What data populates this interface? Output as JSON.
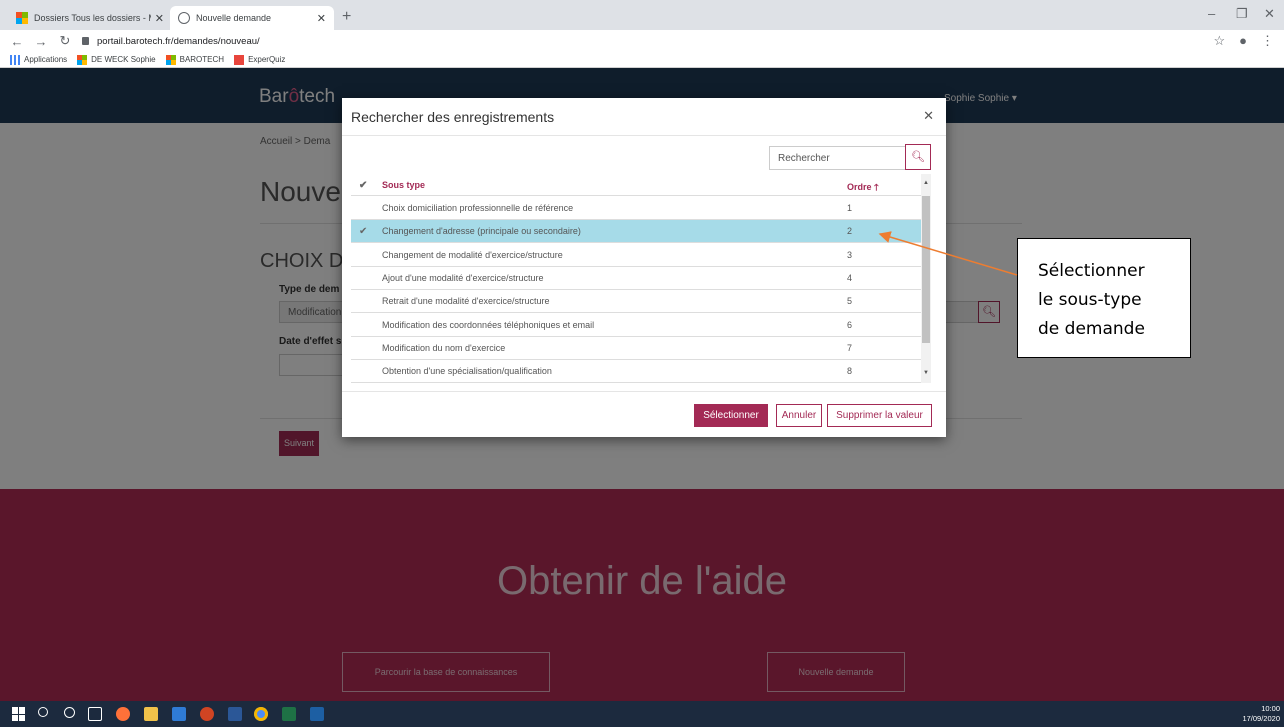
{
  "browser": {
    "tabs": [
      {
        "label": "Dossiers Tous les dossiers - Micr"
      },
      {
        "label": "Nouvelle demande"
      }
    ],
    "url": "portail.barotech.fr/demandes/nouveau/",
    "bookmarks": [
      "Applications",
      "DE WECK Sophie",
      "BAROTECH",
      "ExperQuiz"
    ]
  },
  "site": {
    "logo_a": "Bar",
    "logo_o": "ô",
    "logo_b": "tech",
    "user": "Sophie Sophie ▾",
    "breadcrumb": "Accueil  >  Dema",
    "page_title": "Nouve",
    "section_title": "CHOIX D",
    "type_label": "Type de dem",
    "type_value": "Modification",
    "date_label": "Date d'effet s",
    "next_button": "Suivant",
    "help_title": "Obtenir de l'aide",
    "help_browse": "Parcourir la base de connaissances",
    "help_new": "Nouvelle demande"
  },
  "modal": {
    "title": "Rechercher des enregistrements",
    "search_placeholder": "Rechercher",
    "columns": {
      "check": "✔",
      "sous_type": "Sous type",
      "ordre": "Ordre 🡑"
    },
    "rows": [
      {
        "sous_type": "Choix domiciliation professionnelle de référence",
        "ordre": "1",
        "selected": false
      },
      {
        "sous_type": "Changement d'adresse (principale ou secondaire)",
        "ordre": "2",
        "selected": true
      },
      {
        "sous_type": "Changement de modalité d'exercice/structure",
        "ordre": "3",
        "selected": false
      },
      {
        "sous_type": "Ajout d'une modalité d'exercice/structure",
        "ordre": "4",
        "selected": false
      },
      {
        "sous_type": "Retrait d'une modalité d'exercice/structure",
        "ordre": "5",
        "selected": false
      },
      {
        "sous_type": "Modification des coordonnées téléphoniques et email",
        "ordre": "6",
        "selected": false
      },
      {
        "sous_type": "Modification du nom d'exercice",
        "ordre": "7",
        "selected": false
      },
      {
        "sous_type": "Obtention d'une spécialisation/qualification",
        "ordre": "8",
        "selected": false
      }
    ],
    "buttons": {
      "select": "Sélectionner",
      "cancel": "Annuler",
      "clear": "Supprimer la valeur"
    }
  },
  "callout": {
    "line1": "Sélectionner",
    "line2": "le sous-type",
    "line3": "de demande"
  },
  "taskbar": {
    "time": "10:00",
    "date": "17/09/2020"
  },
  "colors": {
    "brand": "#a32a55",
    "nav": "#1f3a56",
    "selected_row": "#a6dbe8"
  }
}
